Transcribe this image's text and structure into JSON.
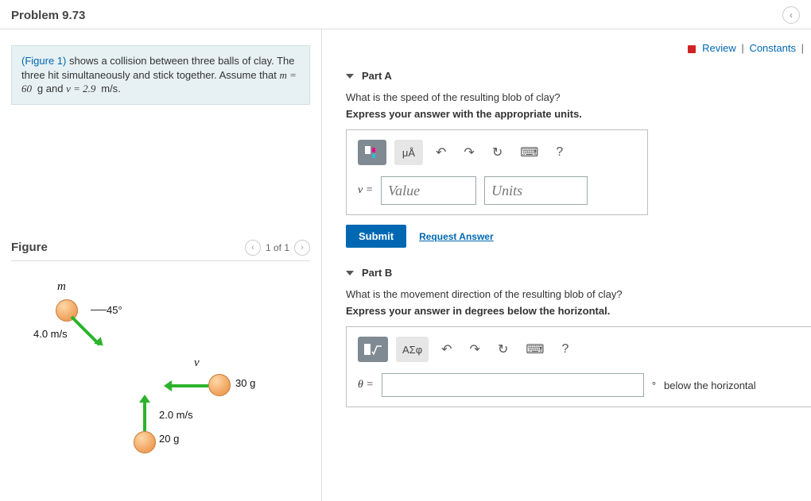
{
  "header": {
    "title": "Problem 9.73"
  },
  "topbar": {
    "review": "Review",
    "constants": "Constants"
  },
  "intro": {
    "figure_link": "(Figure 1)",
    "sentence_rest": "shows a collision between three balls of clay. The three hit simultaneously and stick together. Assume that",
    "m_expr": "m = 60",
    "m_unit": "g",
    "and_word": "and",
    "v_expr": "v = 2.9",
    "v_unit": "m/s",
    "period": "."
  },
  "figure": {
    "heading": "Figure",
    "counter": "1 of 1",
    "labels": {
      "m": "m",
      "angle": "45°",
      "speed1": "4.0 m/s",
      "v": "v",
      "mass2": "30 g",
      "speed3": "2.0 m/s",
      "mass3": "20 g"
    }
  },
  "partA": {
    "label": "Part A",
    "question": "What is the speed of the resulting blob of clay?",
    "instruction": "Express your answer with the appropriate units.",
    "tool_ua": "μÅ",
    "prefix": "v =",
    "value_placeholder": "Value",
    "units_placeholder": "Units",
    "submit": "Submit",
    "request": "Request Answer"
  },
  "partB": {
    "label": "Part B",
    "question": "What is the movement direction of the resulting blob of clay?",
    "instruction": "Express your answer in degrees below the horizontal.",
    "tool_greek": "ΑΣφ",
    "prefix": "θ =",
    "suffix_deg": "°",
    "suffix_text": "below the horizontal"
  },
  "icons": {
    "undo": "↶",
    "redo": "↷",
    "reset": "↻",
    "keyboard": "⌨",
    "help": "?",
    "chevron_left": "‹",
    "chevron_right": "›"
  }
}
